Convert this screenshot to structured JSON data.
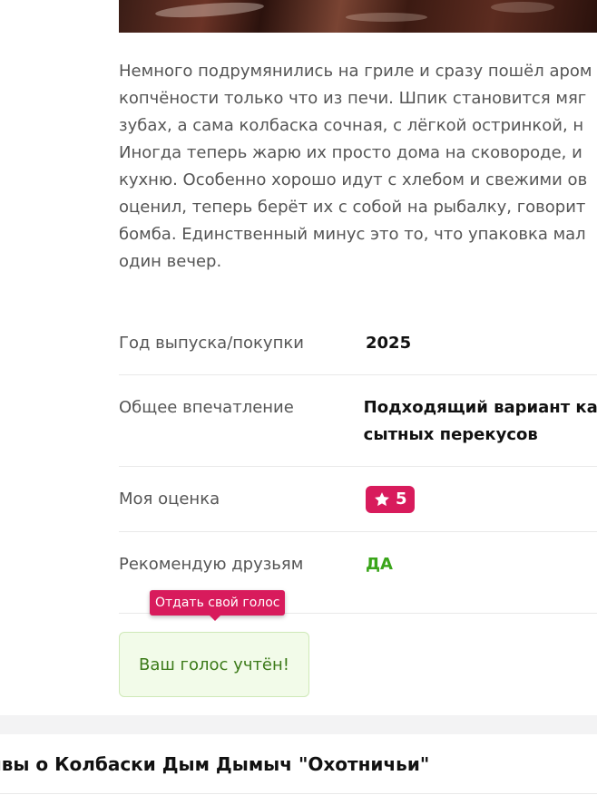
{
  "review": {
    "lines": [
      "Немного подрумянились на гриле и сразу пошёл аром",
      "копчёности только что из печи. Шпик становится мяг",
      "зубах, а сама колбаска сочная, с лёгкой остринкой, н",
      "Иногда теперь жарю их просто дома на сковороде, и",
      "кухню. Особенно хорошо идут с хлебом и свежими ов",
      "оценил, теперь берёт их с собой на рыбалку, говорит",
      "бомба. Единственный минус это то, что упаковка мал",
      "один вечер."
    ]
  },
  "specs": {
    "year": {
      "label": "Год выпуска/покупки",
      "value": "2025"
    },
    "impression": {
      "label": "Общее впечатление",
      "value_line1": "Подходящий вариант как",
      "value_line2": "сытных перекусов"
    },
    "rating": {
      "label": "Моя оценка",
      "value": "5"
    },
    "recommend": {
      "label": "Рекомендую друзьям",
      "value": "ДА"
    }
  },
  "vote": {
    "tooltip": "Отдать свой голос",
    "confirmation": "Ваш голос учтён!"
  },
  "section": {
    "title": "зывы о Колбаски Дым Дымыч \"Охотничьи\""
  },
  "colors": {
    "accent": "#d81b5c",
    "success_text": "#3aa51a",
    "vote_bg": "#f2fbe9"
  },
  "icons": {
    "rating": "star-icon"
  }
}
